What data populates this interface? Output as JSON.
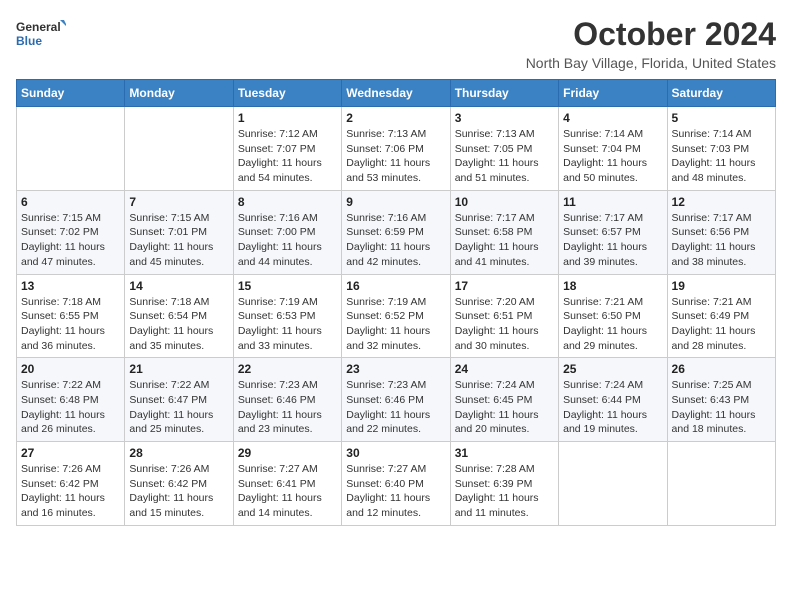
{
  "logo": {
    "general": "General",
    "blue": "Blue"
  },
  "header": {
    "title": "October 2024",
    "location": "North Bay Village, Florida, United States"
  },
  "weekdays": [
    "Sunday",
    "Monday",
    "Tuesday",
    "Wednesday",
    "Thursday",
    "Friday",
    "Saturday"
  ],
  "weeks": [
    [
      {
        "day": "",
        "info": ""
      },
      {
        "day": "",
        "info": ""
      },
      {
        "day": "1",
        "info": "Sunrise: 7:12 AM\nSunset: 7:07 PM\nDaylight: 11 hours and 54 minutes."
      },
      {
        "day": "2",
        "info": "Sunrise: 7:13 AM\nSunset: 7:06 PM\nDaylight: 11 hours and 53 minutes."
      },
      {
        "day": "3",
        "info": "Sunrise: 7:13 AM\nSunset: 7:05 PM\nDaylight: 11 hours and 51 minutes."
      },
      {
        "day": "4",
        "info": "Sunrise: 7:14 AM\nSunset: 7:04 PM\nDaylight: 11 hours and 50 minutes."
      },
      {
        "day": "5",
        "info": "Sunrise: 7:14 AM\nSunset: 7:03 PM\nDaylight: 11 hours and 48 minutes."
      }
    ],
    [
      {
        "day": "6",
        "info": "Sunrise: 7:15 AM\nSunset: 7:02 PM\nDaylight: 11 hours and 47 minutes."
      },
      {
        "day": "7",
        "info": "Sunrise: 7:15 AM\nSunset: 7:01 PM\nDaylight: 11 hours and 45 minutes."
      },
      {
        "day": "8",
        "info": "Sunrise: 7:16 AM\nSunset: 7:00 PM\nDaylight: 11 hours and 44 minutes."
      },
      {
        "day": "9",
        "info": "Sunrise: 7:16 AM\nSunset: 6:59 PM\nDaylight: 11 hours and 42 minutes."
      },
      {
        "day": "10",
        "info": "Sunrise: 7:17 AM\nSunset: 6:58 PM\nDaylight: 11 hours and 41 minutes."
      },
      {
        "day": "11",
        "info": "Sunrise: 7:17 AM\nSunset: 6:57 PM\nDaylight: 11 hours and 39 minutes."
      },
      {
        "day": "12",
        "info": "Sunrise: 7:17 AM\nSunset: 6:56 PM\nDaylight: 11 hours and 38 minutes."
      }
    ],
    [
      {
        "day": "13",
        "info": "Sunrise: 7:18 AM\nSunset: 6:55 PM\nDaylight: 11 hours and 36 minutes."
      },
      {
        "day": "14",
        "info": "Sunrise: 7:18 AM\nSunset: 6:54 PM\nDaylight: 11 hours and 35 minutes."
      },
      {
        "day": "15",
        "info": "Sunrise: 7:19 AM\nSunset: 6:53 PM\nDaylight: 11 hours and 33 minutes."
      },
      {
        "day": "16",
        "info": "Sunrise: 7:19 AM\nSunset: 6:52 PM\nDaylight: 11 hours and 32 minutes."
      },
      {
        "day": "17",
        "info": "Sunrise: 7:20 AM\nSunset: 6:51 PM\nDaylight: 11 hours and 30 minutes."
      },
      {
        "day": "18",
        "info": "Sunrise: 7:21 AM\nSunset: 6:50 PM\nDaylight: 11 hours and 29 minutes."
      },
      {
        "day": "19",
        "info": "Sunrise: 7:21 AM\nSunset: 6:49 PM\nDaylight: 11 hours and 28 minutes."
      }
    ],
    [
      {
        "day": "20",
        "info": "Sunrise: 7:22 AM\nSunset: 6:48 PM\nDaylight: 11 hours and 26 minutes."
      },
      {
        "day": "21",
        "info": "Sunrise: 7:22 AM\nSunset: 6:47 PM\nDaylight: 11 hours and 25 minutes."
      },
      {
        "day": "22",
        "info": "Sunrise: 7:23 AM\nSunset: 6:46 PM\nDaylight: 11 hours and 23 minutes."
      },
      {
        "day": "23",
        "info": "Sunrise: 7:23 AM\nSunset: 6:46 PM\nDaylight: 11 hours and 22 minutes."
      },
      {
        "day": "24",
        "info": "Sunrise: 7:24 AM\nSunset: 6:45 PM\nDaylight: 11 hours and 20 minutes."
      },
      {
        "day": "25",
        "info": "Sunrise: 7:24 AM\nSunset: 6:44 PM\nDaylight: 11 hours and 19 minutes."
      },
      {
        "day": "26",
        "info": "Sunrise: 7:25 AM\nSunset: 6:43 PM\nDaylight: 11 hours and 18 minutes."
      }
    ],
    [
      {
        "day": "27",
        "info": "Sunrise: 7:26 AM\nSunset: 6:42 PM\nDaylight: 11 hours and 16 minutes."
      },
      {
        "day": "28",
        "info": "Sunrise: 7:26 AM\nSunset: 6:42 PM\nDaylight: 11 hours and 15 minutes."
      },
      {
        "day": "29",
        "info": "Sunrise: 7:27 AM\nSunset: 6:41 PM\nDaylight: 11 hours and 14 minutes."
      },
      {
        "day": "30",
        "info": "Sunrise: 7:27 AM\nSunset: 6:40 PM\nDaylight: 11 hours and 12 minutes."
      },
      {
        "day": "31",
        "info": "Sunrise: 7:28 AM\nSunset: 6:39 PM\nDaylight: 11 hours and 11 minutes."
      },
      {
        "day": "",
        "info": ""
      },
      {
        "day": "",
        "info": ""
      }
    ]
  ]
}
